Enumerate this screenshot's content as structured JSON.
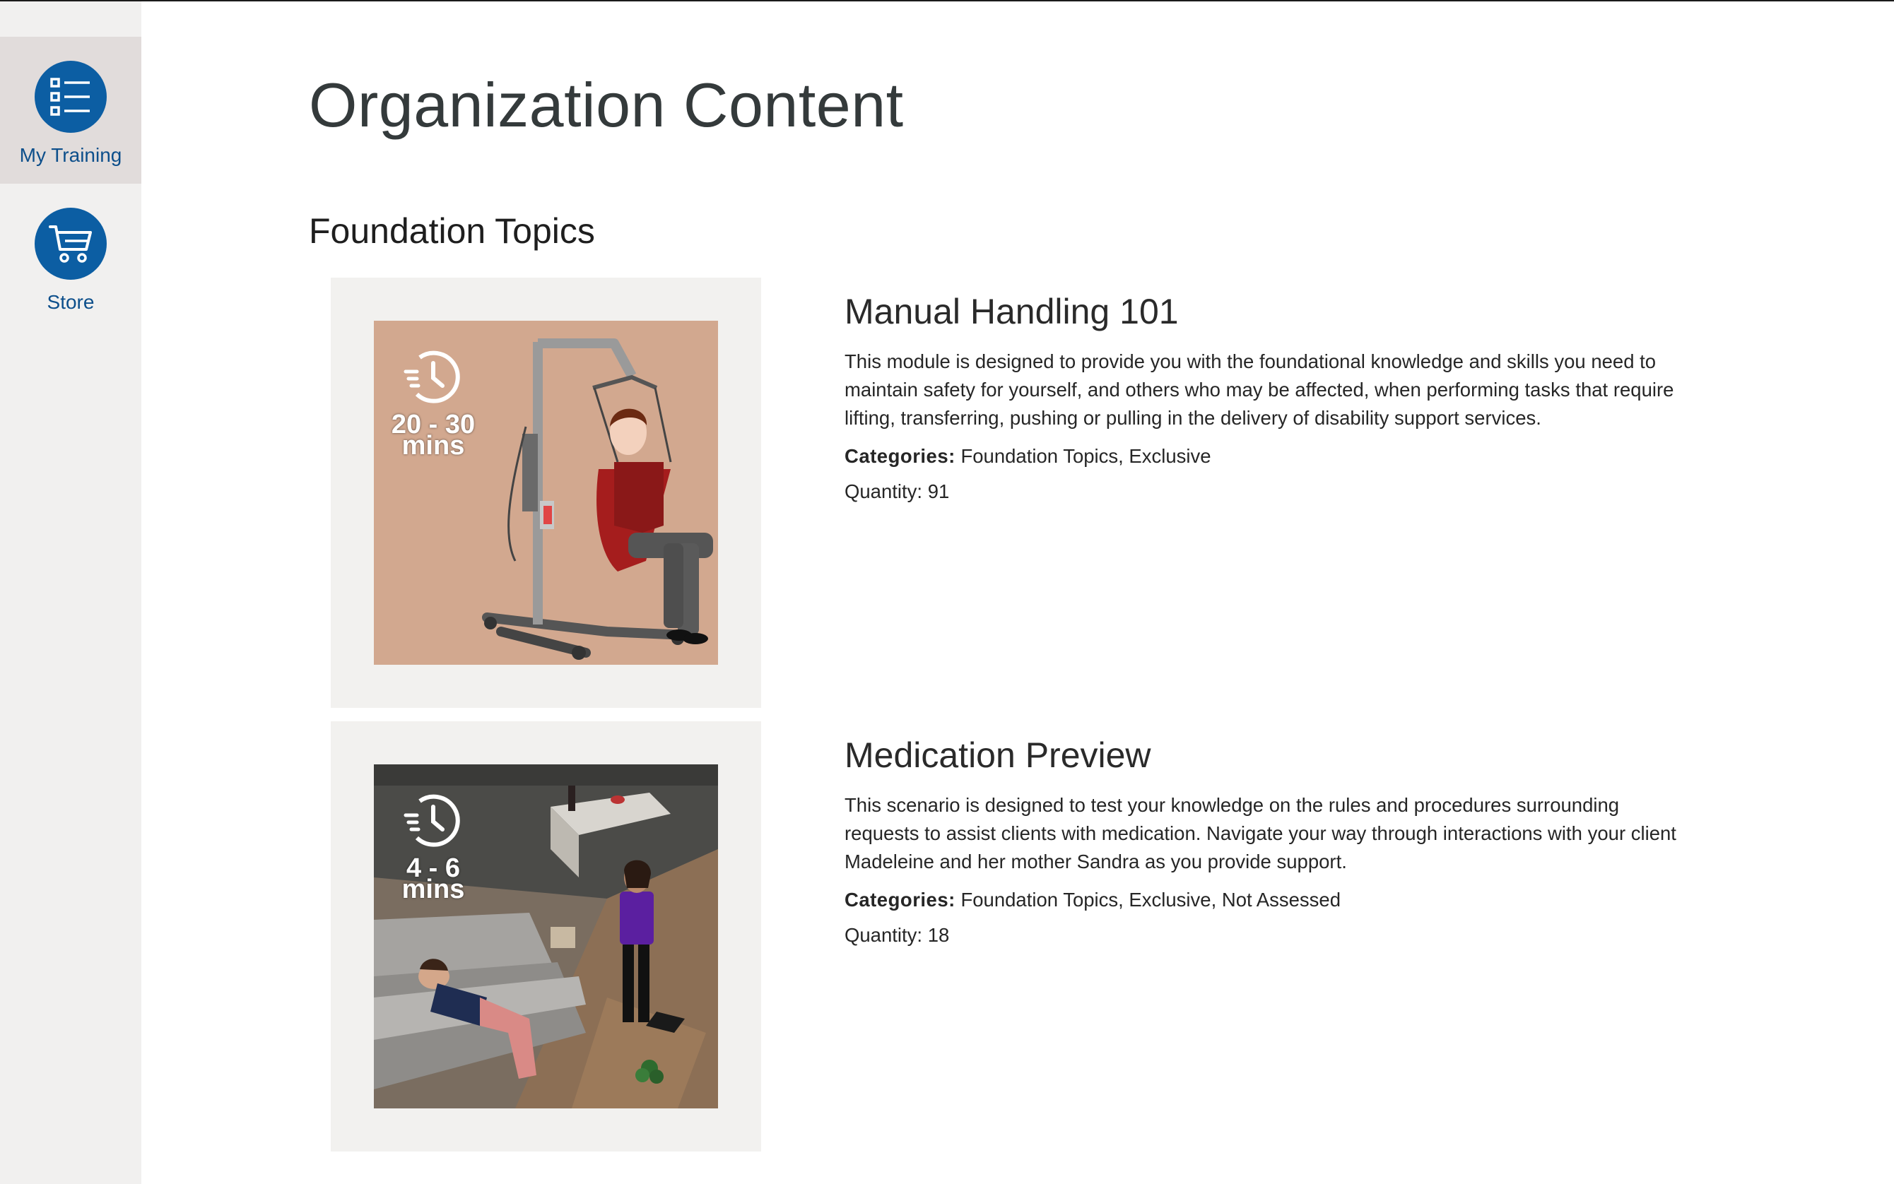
{
  "sidebar": {
    "items": [
      {
        "label": "My Training",
        "icon": "list-icon",
        "active": true
      },
      {
        "label": "Store",
        "icon": "cart-icon",
        "active": false
      }
    ]
  },
  "page": {
    "title": "Organization Content",
    "section_title": "Foundation Topics"
  },
  "modules": [
    {
      "title": "Manual Handling 101",
      "duration_top": "20 - 30",
      "duration_bottom": "mins",
      "description": "This module is designed to provide you with the foundational knowledge and skills you need to maintain safety for yourself, and others who may be affected, when performing tasks that require lifting, transferring, pushing or pulling in the delivery of disability support services.",
      "categories_label": "Categories:",
      "categories": "Foundation Topics, Exclusive",
      "quantity": "Quantity: 91"
    },
    {
      "title": "Medication Preview",
      "duration_top": "4 - 6",
      "duration_bottom": "mins",
      "description": "This scenario is designed to test your knowledge on the rules and procedures surrounding requests to assist clients with medication. Navigate your way through interactions with your client Madeleine and her mother Sandra as you provide support.",
      "categories_label": "Categories:",
      "categories": "Foundation Topics, Exclusive, Not Assessed",
      "quantity": "Quantity: 18"
    }
  ],
  "colors": {
    "accent": "#0c5ea3",
    "nav_label": "#0d4f8b",
    "sidebar_bg": "#f1f0ef",
    "sidebar_active_bg": "#e1dcdb",
    "card_bg": "#f2f1ef"
  }
}
